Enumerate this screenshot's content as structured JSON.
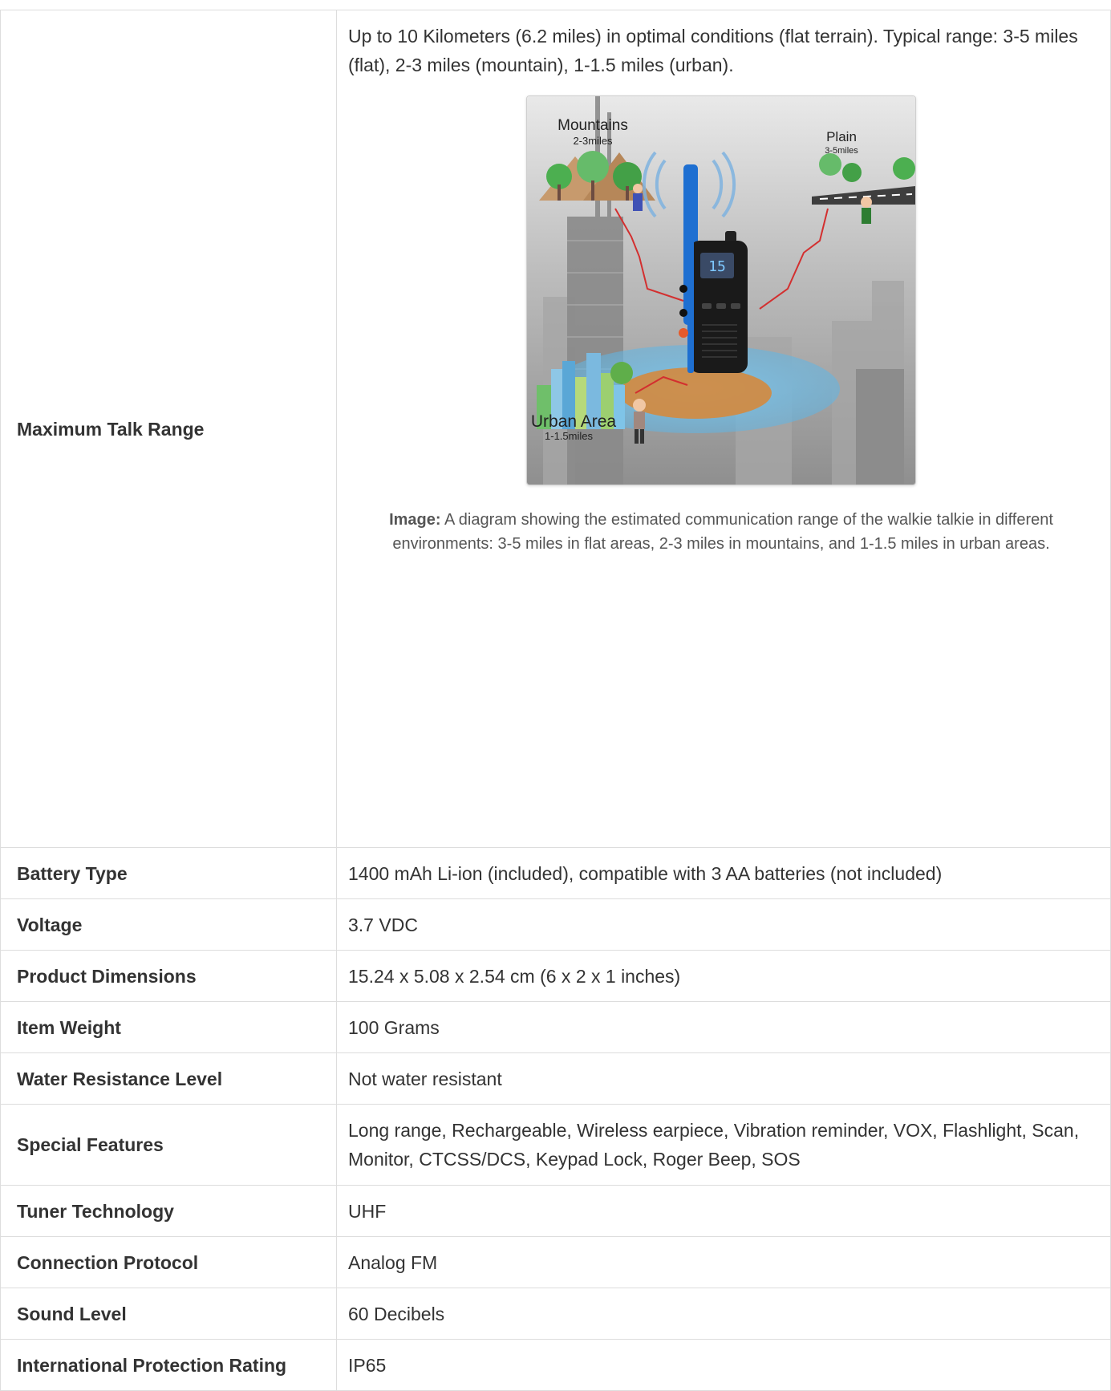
{
  "specs": {
    "range": {
      "label": "Maximum Talk Range",
      "value": "Up to 10 Kilometers (6.2 miles) in optimal conditions (flat terrain). Typical range: 3-5 miles (flat), 2-3 miles (mountain), 1-1.5 miles (urban).",
      "figure": {
        "labels": {
          "mountains": "Mountains",
          "mountains_range": "2-3miles",
          "plain": "Plain",
          "plain_range": "3-5miles",
          "urban": "Urban Area",
          "urban_range": "1-1.5miles"
        },
        "caption_prefix": "Image:",
        "caption_text": "A diagram showing the estimated communication range of the walkie talkie in different environments: 3-5 miles in flat areas, 2-3 miles in mountains, and 1-1.5 miles in urban areas."
      }
    },
    "rows": [
      {
        "label": "Battery Type",
        "value": "1400 mAh Li-ion (included), compatible with 3 AA batteries (not included)"
      },
      {
        "label": "Voltage",
        "value": "3.7 VDC"
      },
      {
        "label": "Product Dimensions",
        "value": "15.24 x 5.08 x 2.54 cm (6 x 2 x 1 inches)"
      },
      {
        "label": "Item Weight",
        "value": "100 Grams"
      },
      {
        "label": "Water Resistance Level",
        "value": "Not water resistant"
      },
      {
        "label": "Special Features",
        "value": "Long range, Rechargeable, Wireless earpiece, Vibration reminder, VOX, Flashlight, Scan, Monitor, CTCSS/DCS, Keypad Lock, Roger Beep, SOS"
      },
      {
        "label": "Tuner Technology",
        "value": "UHF"
      },
      {
        "label": "Connection Protocol",
        "value": "Analog FM"
      },
      {
        "label": "Sound Level",
        "value": "60 Decibels"
      },
      {
        "label": "International Protection Rating",
        "value": "IP65"
      }
    ]
  }
}
